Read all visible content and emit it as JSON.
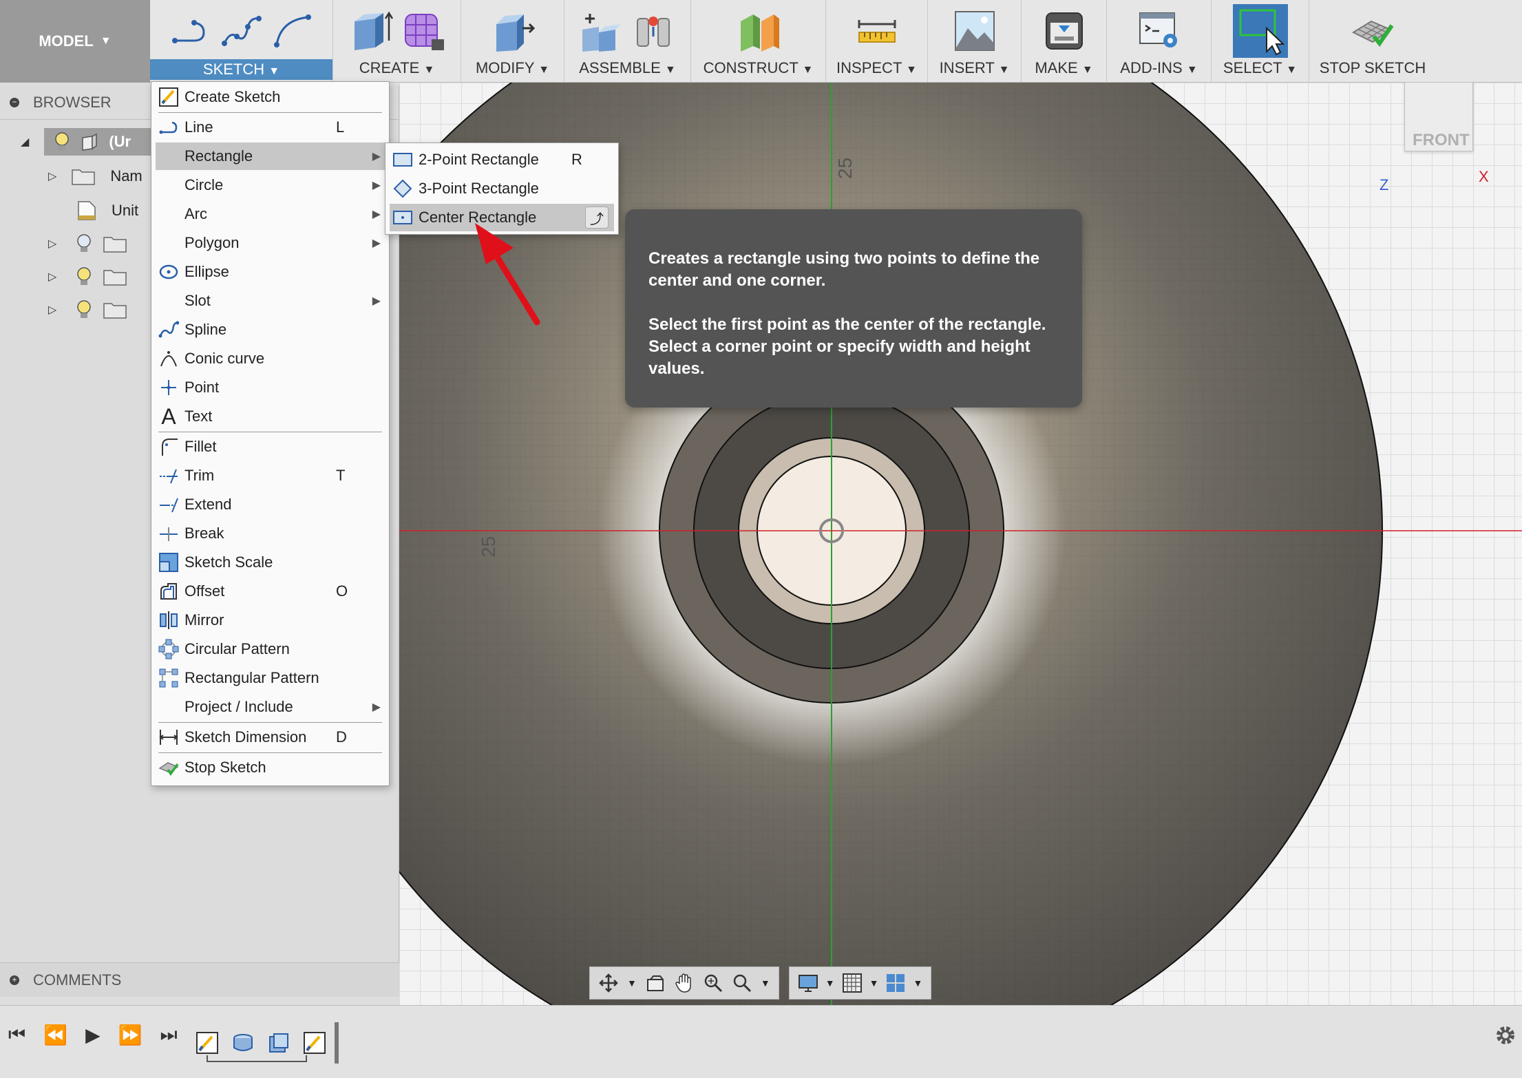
{
  "toolbar": {
    "workspace": "MODEL",
    "groups": [
      {
        "id": "sketch",
        "label": "SKETCH"
      },
      {
        "id": "create",
        "label": "CREATE"
      },
      {
        "id": "modify",
        "label": "MODIFY"
      },
      {
        "id": "assemble",
        "label": "ASSEMBLE"
      },
      {
        "id": "construct",
        "label": "CONSTRUCT"
      },
      {
        "id": "inspect",
        "label": "INSPECT"
      },
      {
        "id": "insert",
        "label": "INSERT"
      },
      {
        "id": "make",
        "label": "MAKE"
      },
      {
        "id": "addins",
        "label": "ADD-INS"
      },
      {
        "id": "select",
        "label": "SELECT"
      },
      {
        "id": "stopsketch",
        "label": "STOP SKETCH"
      }
    ]
  },
  "browser": {
    "title": "BROWSER",
    "root_label": "(Ur",
    "rows": [
      {
        "label": "Nam"
      },
      {
        "label": "Unit"
      }
    ]
  },
  "comments": {
    "title": "COMMENTS"
  },
  "viewcube": {
    "face": "FRONT",
    "axis_x": "X",
    "axis_z": "Z"
  },
  "canvas": {
    "dim_top": "25",
    "dim_left": "25"
  },
  "sketch_menu": {
    "items": [
      {
        "label": "Create Sketch",
        "shortcut": ""
      },
      {
        "label": "Line",
        "shortcut": "L"
      },
      {
        "label": "Rectangle",
        "shortcut": ""
      },
      {
        "label": "Circle",
        "shortcut": ""
      },
      {
        "label": "Arc",
        "shortcut": ""
      },
      {
        "label": "Polygon",
        "shortcut": ""
      },
      {
        "label": "Ellipse",
        "shortcut": ""
      },
      {
        "label": "Slot",
        "shortcut": ""
      },
      {
        "label": "Spline",
        "shortcut": ""
      },
      {
        "label": "Conic curve",
        "shortcut": ""
      },
      {
        "label": "Point",
        "shortcut": ""
      },
      {
        "label": "Text",
        "shortcut": ""
      },
      {
        "label": "Fillet",
        "shortcut": ""
      },
      {
        "label": "Trim",
        "shortcut": "T"
      },
      {
        "label": "Extend",
        "shortcut": ""
      },
      {
        "label": "Break",
        "shortcut": ""
      },
      {
        "label": "Sketch Scale",
        "shortcut": ""
      },
      {
        "label": "Offset",
        "shortcut": "O"
      },
      {
        "label": "Mirror",
        "shortcut": ""
      },
      {
        "label": "Circular Pattern",
        "shortcut": ""
      },
      {
        "label": "Rectangular Pattern",
        "shortcut": ""
      },
      {
        "label": "Project / Include",
        "shortcut": ""
      },
      {
        "label": "Sketch Dimension",
        "shortcut": "D"
      },
      {
        "label": "Stop Sketch",
        "shortcut": ""
      }
    ]
  },
  "rectangle_submenu": {
    "items": [
      {
        "label": "2-Point Rectangle",
        "shortcut": "R"
      },
      {
        "label": "3-Point Rectangle",
        "shortcut": ""
      },
      {
        "label": "Center Rectangle",
        "shortcut": ""
      }
    ]
  },
  "tooltip": {
    "line1": "Creates a rectangle using two points to define the center and one corner.",
    "line2": "Select the first point as the center of the rectangle. Select a corner point or specify width and height values."
  },
  "colors": {
    "accent": "#4e8cc2",
    "arrow": "#e0101a",
    "x_axis": "#d0202a",
    "y_axis": "#2ea02e"
  }
}
